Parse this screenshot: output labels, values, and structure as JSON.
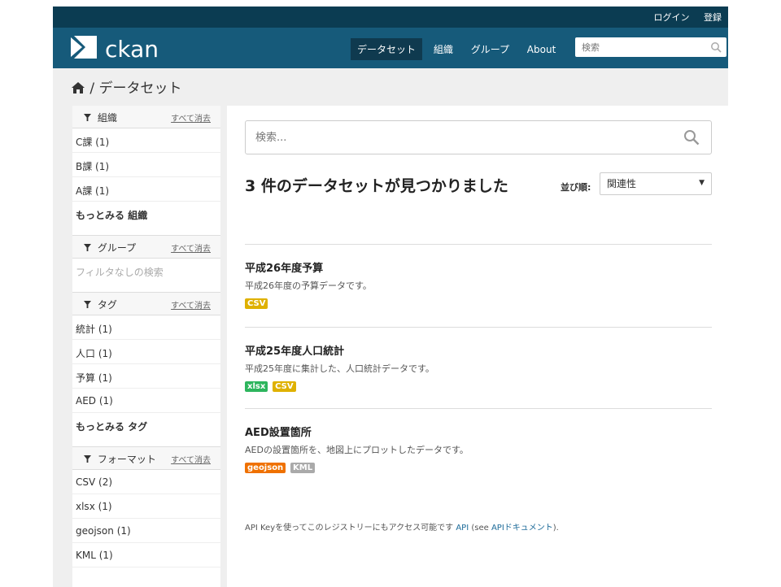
{
  "topbar": {
    "login": "ログイン",
    "register": "登録"
  },
  "header": {
    "logo_text": "ckan",
    "nav": [
      {
        "label": "データセット",
        "active": true
      },
      {
        "label": "組織",
        "active": false
      },
      {
        "label": "グループ",
        "active": false
      },
      {
        "label": "About",
        "active": false
      }
    ],
    "search_placeholder": "検索"
  },
  "breadcrumb": {
    "separator": "/",
    "current": "データセット"
  },
  "sidebar": {
    "clear_label": "すべて消去",
    "facets": [
      {
        "title": "組織",
        "items": [
          "C課 (1)",
          "B課 (1)",
          "A課 (1)"
        ],
        "more": "もっとみる 組織"
      },
      {
        "title": "グループ",
        "empty": "フィルタなしの検索"
      },
      {
        "title": "タグ",
        "items": [
          "統計 (1)",
          "人口 (1)",
          "予算 (1)",
          "AED (1)"
        ],
        "more": "もっとみる タグ"
      },
      {
        "title": "フォーマット",
        "items": [
          "CSV (2)",
          "xlsx (1)",
          "geojson (1)",
          "KML (1)"
        ]
      }
    ]
  },
  "main": {
    "search_placeholder": "検索...",
    "result_count": "3 件のデータセットが見つかりました",
    "sort_label": "並び順:",
    "sort_value": "関連性",
    "datasets": [
      {
        "title": "平成26年度予算",
        "notes": "平成26年度の予算データです。",
        "formats": [
          {
            "label": "CSV",
            "color": "#dfb100"
          }
        ]
      },
      {
        "title": "平成25年度人口統計",
        "notes": "平成25年度に集計した、人口統計データです。",
        "formats": [
          {
            "label": "xlsx",
            "color": "#2db55d"
          },
          {
            "label": "CSV",
            "color": "#dfb100"
          }
        ]
      },
      {
        "title": "AED設置箇所",
        "notes": "AEDの設置箇所を、地図上にプロットしたデータです。",
        "formats": [
          {
            "label": "geojson",
            "color": "#ef7100"
          },
          {
            "label": "KML",
            "color": "#aaaaaa"
          }
        ]
      }
    ],
    "api_note": {
      "prefix": "API Keyを使ってこのレジストリーにもアクセス可能です",
      "link1": "API",
      "middle": "(see",
      "link2": "APIドキュメント",
      "suffix": ")."
    }
  },
  "colors": {
    "masthead": "#165a7a",
    "topbar": "#0b3c52",
    "link": "#1d6b99"
  }
}
